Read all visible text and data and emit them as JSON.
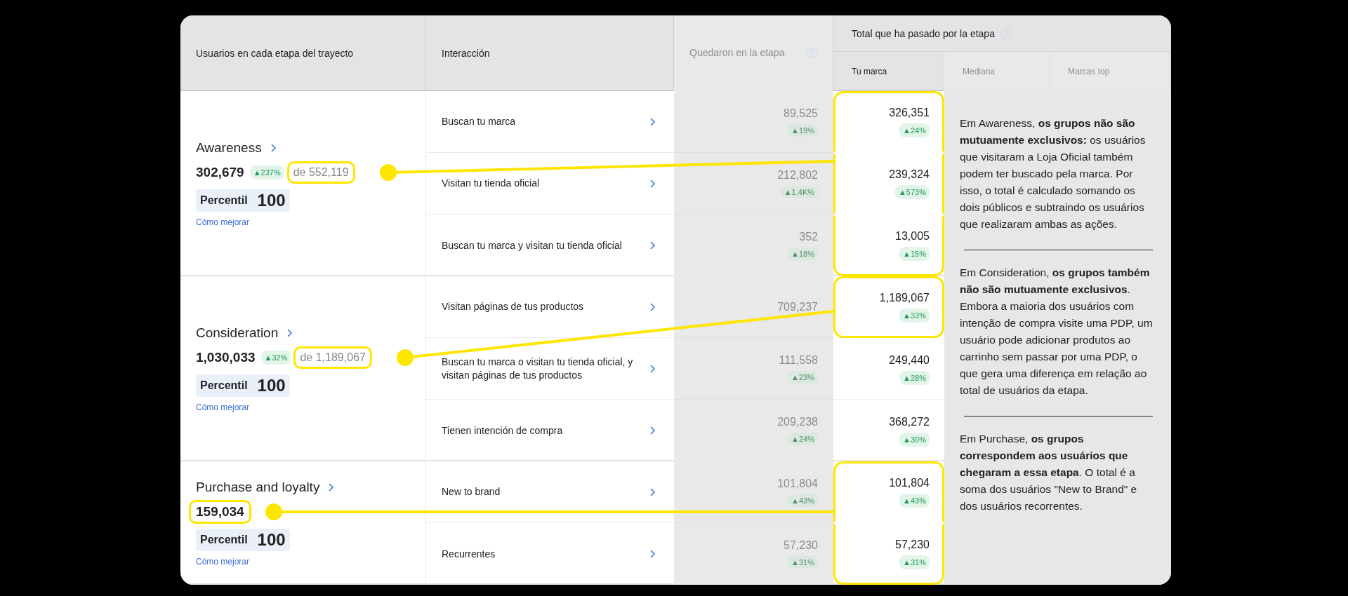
{
  "header": {
    "stage_column": "Usuarios en cada etapa del trayecto",
    "interaction_column": "Interacción",
    "remained_column": "Quedaron en la etapa",
    "total_group": "Total que ha pasado por la etapa",
    "total_subcolumns": [
      {
        "label": "Tu marca",
        "faded": false
      },
      {
        "label": "Mediana",
        "faded": true
      },
      {
        "label": "Marcas top",
        "faded": true
      }
    ]
  },
  "stages": [
    {
      "name": "Awareness",
      "total": {
        "text": "302,679",
        "highlighted": false
      },
      "change": "▲237%",
      "of_total": {
        "text": "de 552,119",
        "highlighted": true
      },
      "percentile_label": "Percentil",
      "percentile": "100",
      "link": "Cómo mejorar",
      "callout": true,
      "rows": [
        {
          "interaction": "Buscan tu marca",
          "remained": "89,525",
          "remained_change": "▲19%",
          "brand_total": "326,351",
          "brand_change": "▲24%",
          "highlighted": true
        },
        {
          "interaction": "Visitan tu tienda oficial",
          "remained": "212,802",
          "remained_change": "▲1.4K%",
          "brand_total": "239,324",
          "brand_change": "▲573%",
          "highlighted": true
        },
        {
          "interaction": "Buscan tu marca y visitan tu tienda oficial",
          "remained": "352",
          "remained_change": "▲18%",
          "brand_total": "13,005",
          "brand_change": "▲15%",
          "highlighted": true
        }
      ]
    },
    {
      "name": "Consideration",
      "total": {
        "text": "1,030,033",
        "highlighted": false
      },
      "change": "▲32%",
      "of_total": {
        "text": "de 1,189,067",
        "highlighted": true
      },
      "percentile_label": "Percentil",
      "percentile": "100",
      "link": "Cómo mejorar",
      "callout": true,
      "rows": [
        {
          "interaction": "Visitan páginas de tus productos",
          "remained": "709,237",
          "brand_total": "1,189,067",
          "brand_change": "▲33%",
          "highlighted": true
        },
        {
          "interaction": "Buscan tu marca o visitan tu tienda oficial, y visitan páginas de tus productos",
          "remained": "111,558",
          "remained_change": "▲23%",
          "brand_total": "249,440",
          "brand_change": "▲28%",
          "highlighted": false
        },
        {
          "interaction": "Tienen intención de compra",
          "remained": "209,238",
          "remained_change": "▲24%",
          "brand_total": "368,272",
          "brand_change": "▲30%",
          "highlighted": false
        }
      ]
    },
    {
      "name": "Purchase and loyalty",
      "total": {
        "text": "159,034",
        "highlighted": true
      },
      "percentile_label": "Percentil",
      "percentile": "100",
      "link": "Cómo mejorar",
      "callout": true,
      "rows": [
        {
          "interaction": "New to brand",
          "remained": "101,804",
          "remained_change": "▲43%",
          "brand_total": "101,804",
          "brand_change": "▲43%",
          "highlighted": true
        },
        {
          "interaction": "Recurrentes",
          "remained": "57,230",
          "remained_change": "▲31%",
          "brand_total": "57,230",
          "brand_change": "▲31%",
          "highlighted": true
        }
      ]
    }
  ],
  "notes": [
    "Em Awareness, **os grupos não são mutuamente exclusivos:** os usuários que visitaram a Loja Oficial também podem ter buscado pela marca. Por isso, o total é calculado somando os dois públicos e subtraindo os usuários que realizaram ambas as ações.",
    "Em Consideration, **os grupos também não são mutuamente exclusivos**. Embora a maioria dos usuários com intenção de compra visite uma PDP, um usuário pode adicionar produtos ao carrinho sem passar por uma PDP, o que gera uma diferença em relação ao total de usuários da etapa.",
    "Em Purchase, **os grupos correspondem aos usuários que chegaram a essa etapa**. O total é a soma dos usuários \"New to Brand\" e dos usuários recorrentes."
  ]
}
